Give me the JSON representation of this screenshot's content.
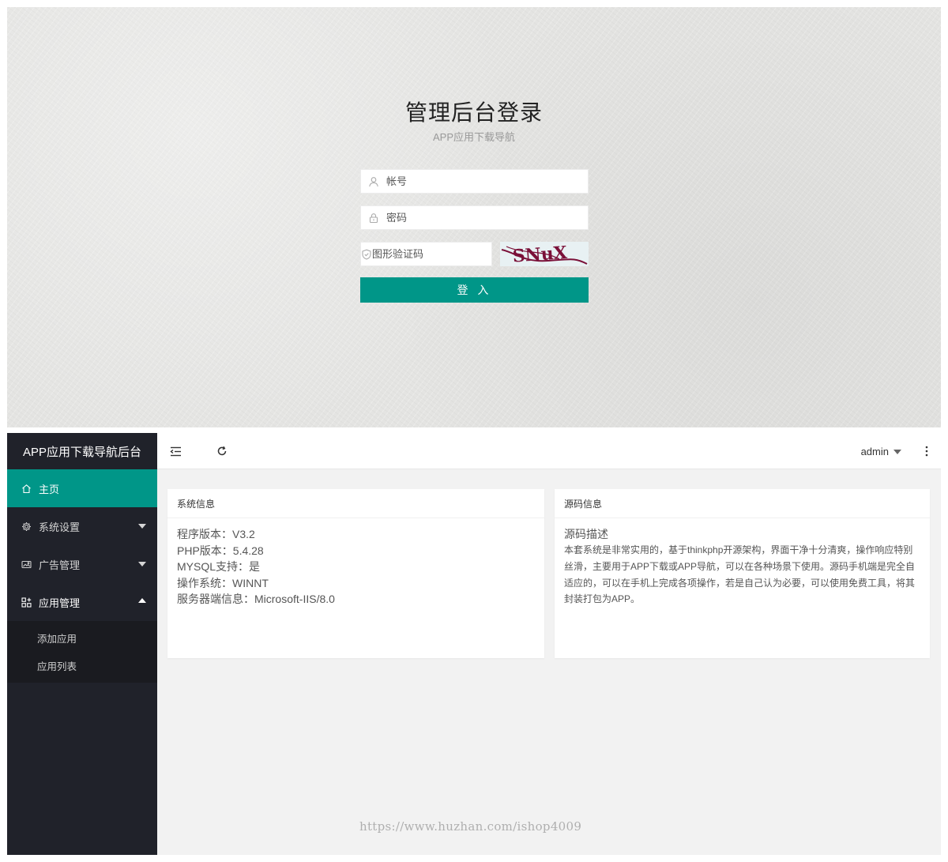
{
  "login": {
    "title": "管理后台登录",
    "subtitle": "APP应用下载导航",
    "account_placeholder": "帐号",
    "password_placeholder": "密码",
    "captcha_placeholder": "图形验证码",
    "captcha_text": "SNuX",
    "submit_label": "登 入"
  },
  "admin": {
    "logo_text": "APP应用下载导航后台",
    "nav": [
      {
        "label": "主页",
        "icon": "home-icon"
      },
      {
        "label": "系统设置",
        "icon": "gear-icon"
      },
      {
        "label": "广告管理",
        "icon": "image-icon"
      },
      {
        "label": "应用管理",
        "icon": "apps-icon"
      }
    ],
    "subnav": [
      {
        "label": "添加应用"
      },
      {
        "label": "应用列表"
      }
    ],
    "user": "admin",
    "system_card": {
      "title": "系统信息",
      "lines": [
        "程序版本：V3.2",
        "PHP版本：5.4.28",
        "MYSQL支持：是",
        "操作系统：WINNT",
        "服务器端信息：Microsoft-IIS/8.0"
      ]
    },
    "source_card": {
      "title": "源码信息",
      "heading": "源码描述",
      "description": "本套系统是非常实用的，基于thinkphp开源架构，界面干净十分清爽，操作响应特别丝滑，主要用于APP下载或APP导航，可以在各种场景下使用。源码手机端是完全自适应的，可以在手机上完成各项操作，若是自己认为必要，可以使用免费工具，将其封装打包为APP。"
    }
  },
  "watermark": "https://www.huzhan.com/ishop4009",
  "colors": {
    "accent": "#009688",
    "sidebar": "#20222a",
    "subnav": "#1a1b20",
    "captcha_text": "#7a1038"
  }
}
